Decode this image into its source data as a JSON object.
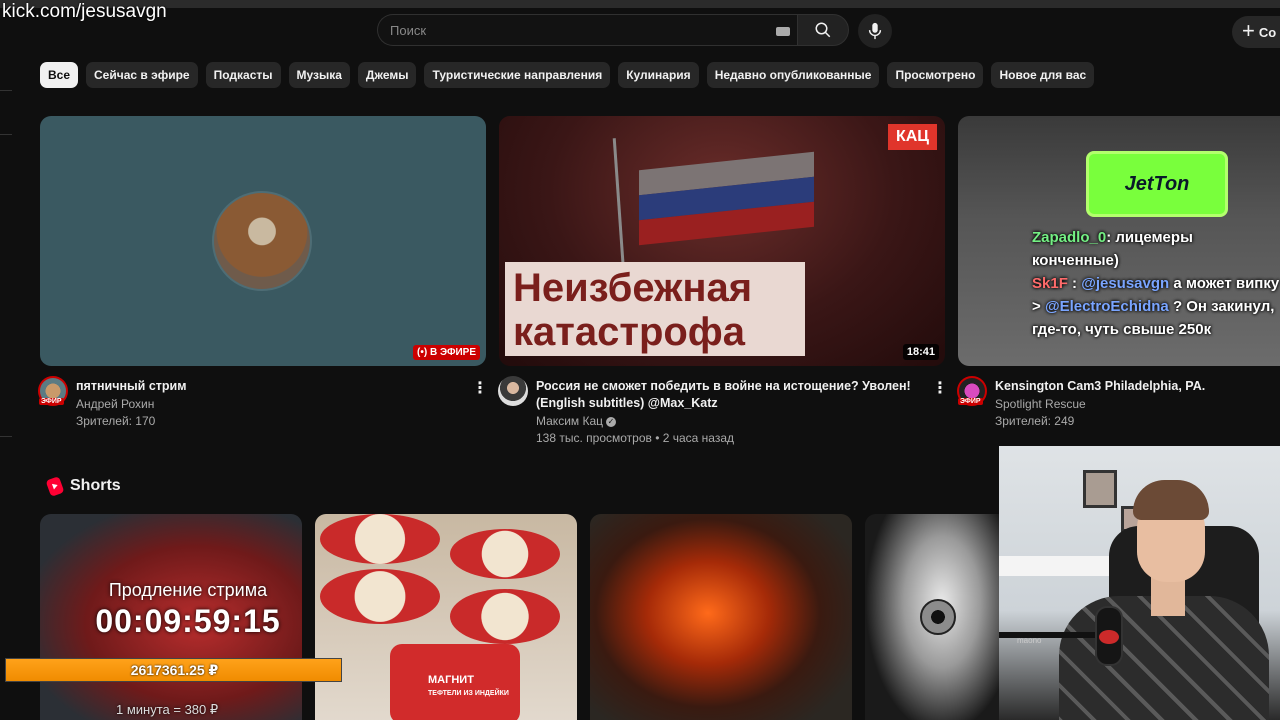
{
  "watermark": "kick.com/jesusavgn",
  "search": {
    "placeholder": "Поиск"
  },
  "header": {
    "create_label": "Со"
  },
  "chips": [
    "Все",
    "Сейчас в эфире",
    "Подкасты",
    "Музыка",
    "Джемы",
    "Туристические направления",
    "Кулинария",
    "Недавно опубликованные",
    "Просмотрено",
    "Новое для вас"
  ],
  "videos": [
    {
      "title": "пятничный стрим",
      "channel": "Андрей Рохин",
      "stats": "Зрителей: 170",
      "badge": "ЭФИР",
      "thumb_badge": "(•) В ЭФИРЕ"
    },
    {
      "title_line1": "Россия не сможет победить в войне на истощение? Уволен!",
      "title_line2": "(English subtitles) @Max_Katz",
      "channel": "Максим Кац",
      "stats": "138 тыс. просмотров • 2 часа назад",
      "duration": "18:41",
      "thumb_logo": "КАЦ",
      "thumb_text_line1": "Неизбежная",
      "thumb_text_line2": "катастрофа"
    },
    {
      "title": "Kensington Cam3  Philadelphia, PA.",
      "channel": "Spotlight Rescue",
      "stats": "Зрителей: 249",
      "badge": "ЭФИР",
      "thumb_logo": "JetTon"
    }
  ],
  "chat": {
    "msg1_user": "Zapadlo_0",
    "msg1_text": ": лицемеры конченные)",
    "msg2_user": "Sk1F",
    "msg2_sep": ":",
    "msg2_mention1": "@jesusavgn",
    "msg2_text1": "а может випку >",
    "msg2_mention2": "@ElectroEchidna",
    "msg2_text2": "? Он закинул, где-то, чуть свыше 250к"
  },
  "shorts": {
    "heading": "Shorts",
    "can_label": "МАГНИТ",
    "can_sub": "ТЕФТЕЛИ ИЗ ИНДЕЙКИ"
  },
  "stream_overlay": {
    "label": "Продление стрима",
    "timer": "00:09:59:15",
    "donation_amount": "2617361.25 ₽",
    "donation_progress": 1.0,
    "rate": "1 минута = 380 ₽"
  },
  "webcam": {
    "mic_brand": "maono"
  },
  "colors": {
    "accent_live": "#cc0000",
    "donation": "#f08c00",
    "chat_user1": "#74f084",
    "chat_user2": "#ff6b6b",
    "chat_mention": "#7aa5ff"
  }
}
